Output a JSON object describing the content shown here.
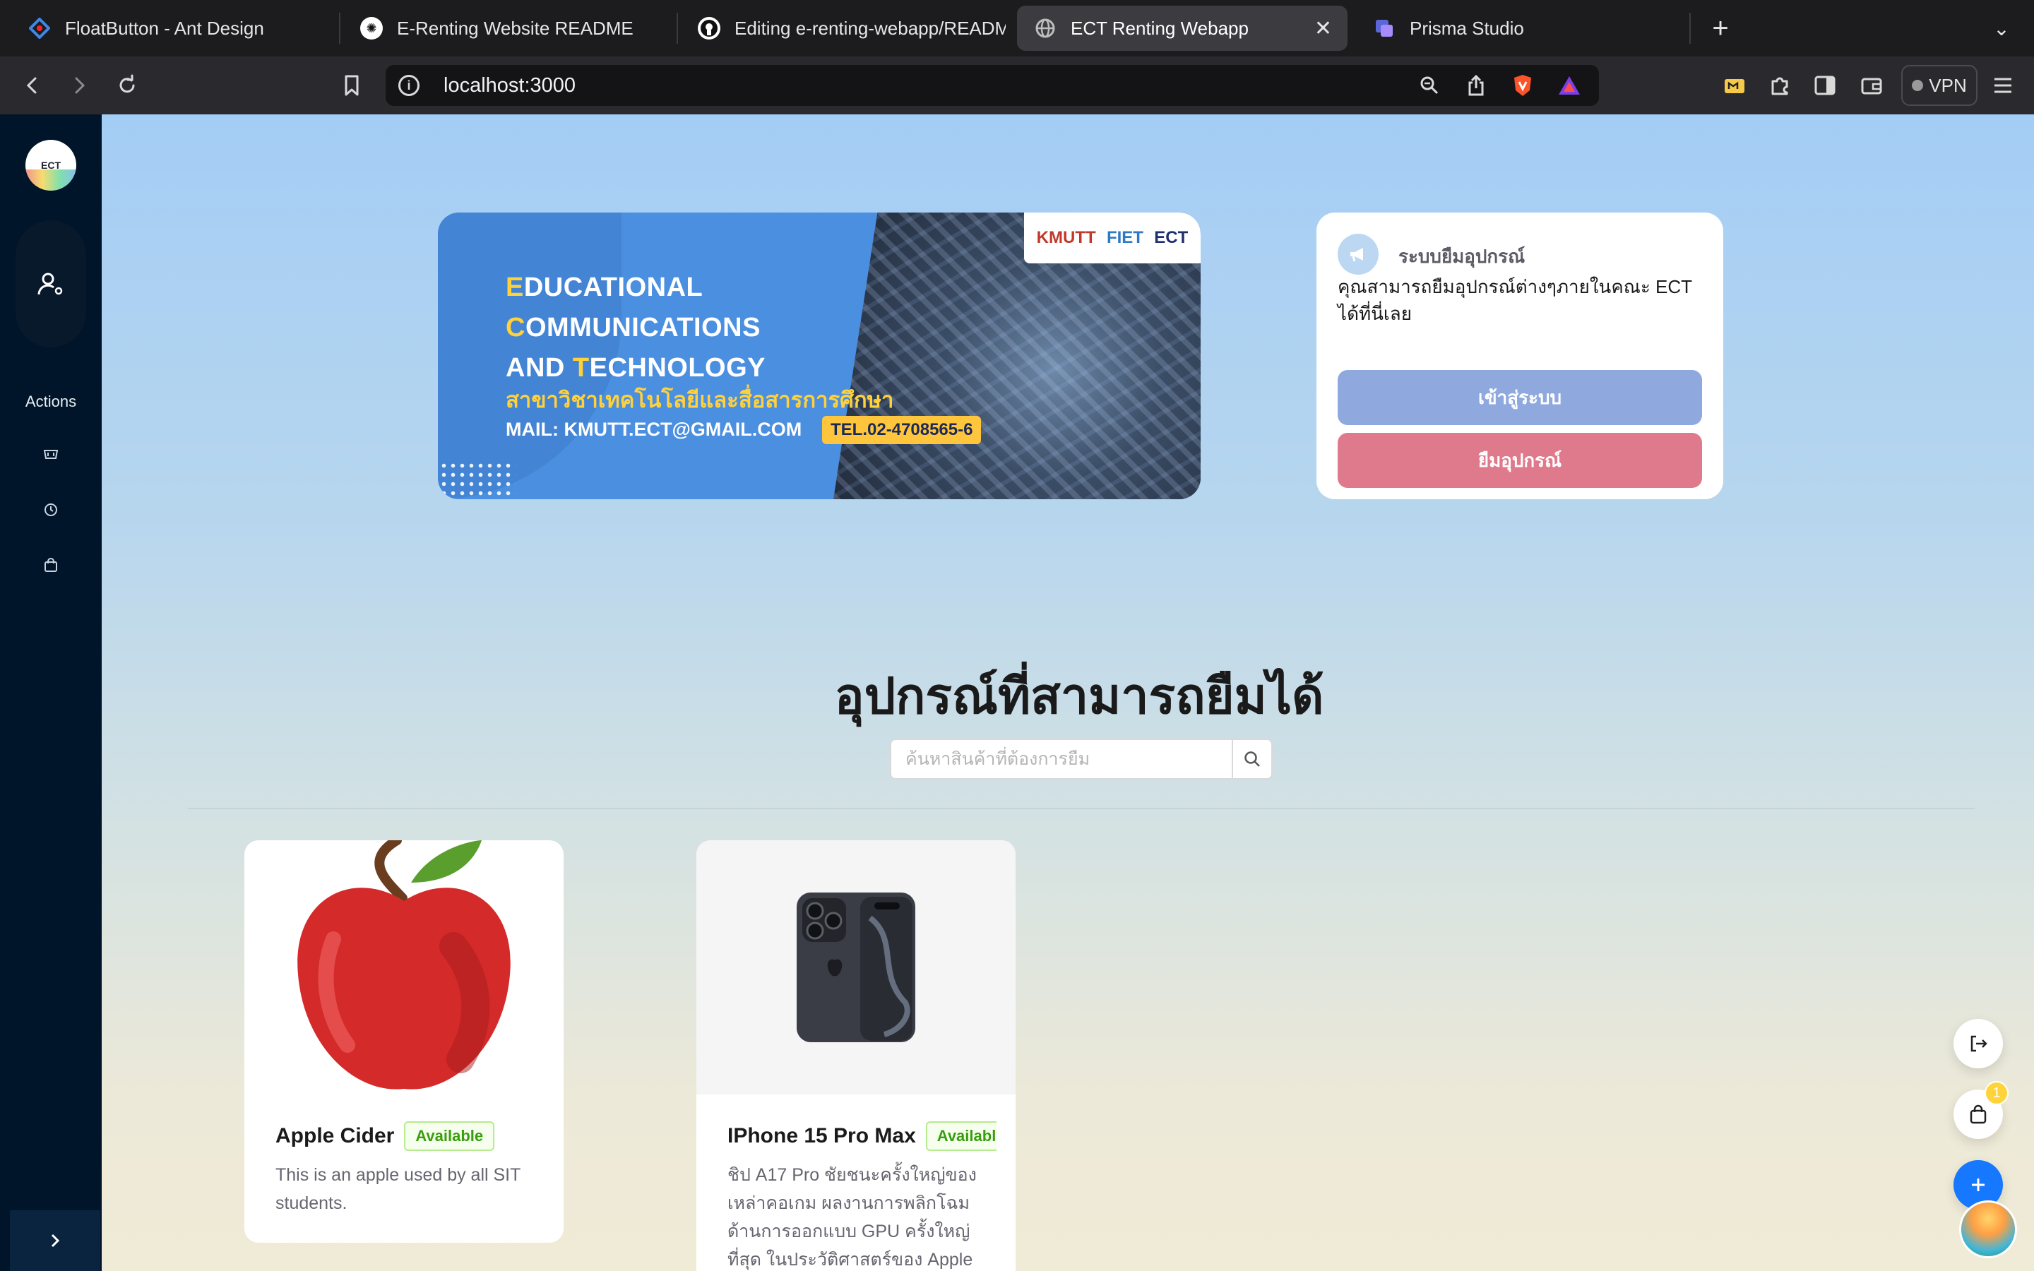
{
  "browser": {
    "tabs": [
      {
        "title": "FloatButton - Ant Design",
        "favicon": "ant-design-icon"
      },
      {
        "title": "E-Renting Website README",
        "favicon": "chatgpt-icon"
      },
      {
        "title": "Editing e-renting-webapp/README",
        "favicon": "github-icon"
      },
      {
        "title": "ECT Renting Webapp",
        "favicon": "globe-icon",
        "active": true
      },
      {
        "title": "Prisma Studio",
        "favicon": "prisma-icon"
      }
    ],
    "url": "localhost:3000",
    "vpn_label": "VPN"
  },
  "sidebar": {
    "logo_text": "ECT",
    "actions_label": "Actions"
  },
  "banner": {
    "line1_first": "E",
    "line1_rest": "DUCATIONAL",
    "line2_first": "C",
    "line2_rest": "OMMUNICATIONS",
    "line3_prefix": "AND ",
    "line3_first": "T",
    "line3_rest": "ECHNOLOGY",
    "thai_subtitle": "สาขาวิชาเทคโนโลยีและสื่อสารการศึกษา",
    "mail": "MAIL: KMUTT.ECT@GMAIL.COM",
    "tel": "TEL.02-4708565-6",
    "logo_kmutt": "KMUTT",
    "logo_fiet": "FIET",
    "logo_ect": "ECT"
  },
  "info_card": {
    "title": "ระบบยืมอุปกรณ์",
    "description": "คุณสามารถยืมอุปกรณ์ต่างๆภายในคณะ ECT ได้ที่นี่เลย",
    "login_button": "เข้าสู่ระบบ",
    "borrow_button": "ยืมอุปกรณ์"
  },
  "section": {
    "title": "อุปกรณ์ที่สามารถยืมได้",
    "search_placeholder": "ค้นหาสินค้าที่ต้องการยืม"
  },
  "products": [
    {
      "name": "Apple Cider",
      "status": "Available",
      "description": "This is an apple used by all SIT students."
    },
    {
      "name": "IPhone 15 Pro Max",
      "status": "Available",
      "description": "ชิป A17 Pro ชัยชนะครั้งใหญ่ของเหล่าคอเกม ผลงานการพลิกโฉมด้านการออกแบบ GPU ครั้งใหญ่ที่สุด ในประวัติศาสตร์ของ Apple"
    }
  ],
  "float_buttons": {
    "cart_badge": "1"
  },
  "colors": {
    "sidebar_bg": "#001529",
    "login_button": "#8fa9de",
    "borrow_button": "#df7a8c",
    "available_tag": "#389e0d",
    "primary": "#1677ff"
  }
}
